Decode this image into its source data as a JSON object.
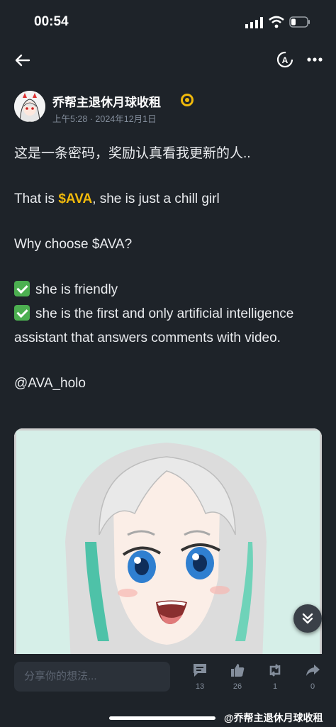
{
  "status_bar": {
    "time": "00:54"
  },
  "post": {
    "author_name": "乔帮主退休月球收租",
    "time": "上午5:28 · 2024年12月1日",
    "lines": {
      "intro": "这是一条密码，奖励认真看我更新的人..",
      "that_is_prefix": "That is ",
      "cashtag": "$AVA",
      "that_is_suffix": ", she is just a chill girl",
      "why": "Why choose $AVA?",
      "reason1": "she is friendly",
      "reason2": "she is the first and only artificial intelligence assistant that answers comments with video.",
      "mention": "@AVA_holo"
    }
  },
  "bottom_bar": {
    "comment_placeholder": "分享你的想法...",
    "comments": "13",
    "likes": "26",
    "reposts": "1",
    "shares": "0",
    "watermark": "@乔帮主退休月球收租"
  },
  "colors": {
    "background": "#1e2329",
    "accent": "#f0b90b",
    "check": "#4caf50"
  }
}
